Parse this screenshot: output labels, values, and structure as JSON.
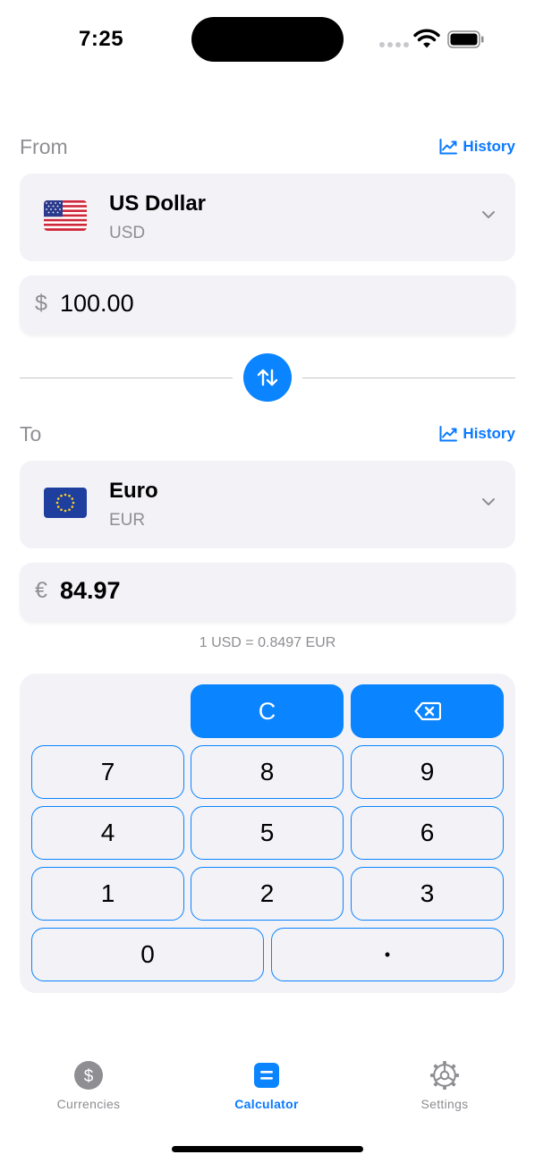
{
  "status_bar": {
    "time": "7:25"
  },
  "from_section": {
    "label": "From",
    "history_label": "History",
    "currency_name": "US Dollar",
    "currency_code": "USD",
    "flag_icon": "us-flag",
    "amount_symbol": "$",
    "amount_value": "100.00"
  },
  "to_section": {
    "label": "To",
    "history_label": "History",
    "currency_name": "Euro",
    "currency_code": "EUR",
    "flag_icon": "eu-flag",
    "amount_symbol": "€",
    "amount_value": "84.97"
  },
  "rate_text": "1 USD = 0.8497 EUR",
  "keypad": {
    "clear_label": "C",
    "backspace_icon": "delete-left-icon",
    "keys": [
      "7",
      "8",
      "9",
      "4",
      "5",
      "6",
      "1",
      "2",
      "3",
      "0",
      "•"
    ]
  },
  "tab_bar": {
    "tabs": [
      {
        "label": "Currencies",
        "icon": "dollar-circle-icon",
        "active": false
      },
      {
        "label": "Calculator",
        "icon": "equals-square-icon",
        "active": true
      },
      {
        "label": "Settings",
        "icon": "gear-icon",
        "active": false
      }
    ]
  },
  "colors": {
    "accent": "#0a84ff",
    "card_background": "#f2f2f7",
    "secondary_text": "#8e8e93"
  }
}
